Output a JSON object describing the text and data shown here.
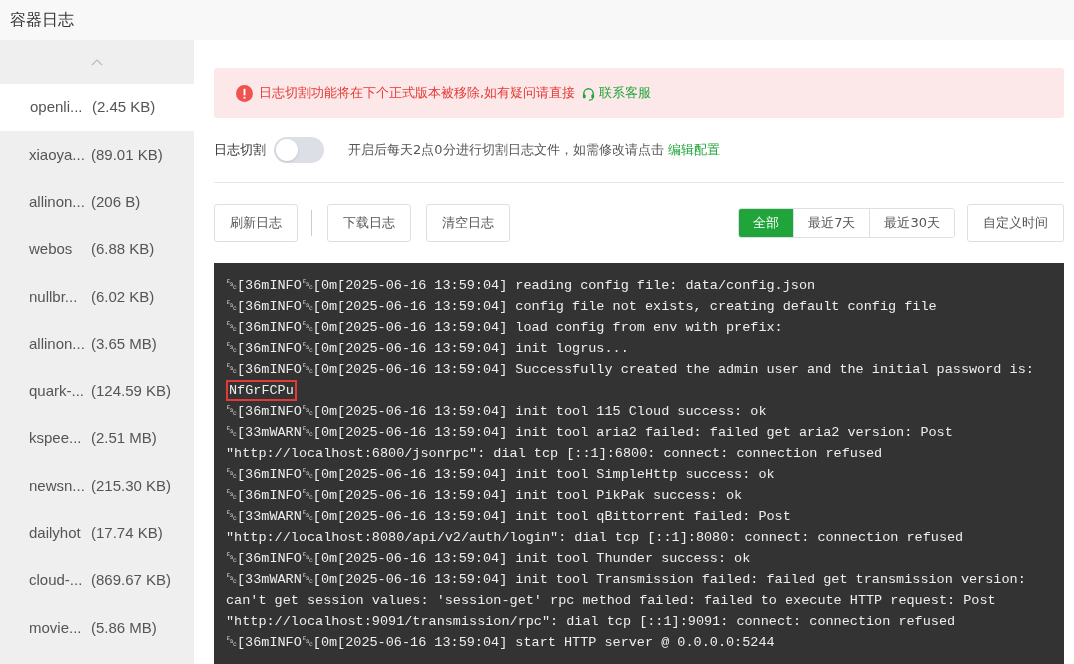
{
  "header": {
    "title": "容器日志"
  },
  "sidebar": {
    "items": [
      {
        "name": "openli...",
        "size": "(2.45 KB)",
        "selected": true
      },
      {
        "name": "xiaoya...",
        "size": "(89.01 KB)",
        "selected": false
      },
      {
        "name": "allinon...",
        "size": "(206 B)",
        "selected": false
      },
      {
        "name": "webos",
        "size": "(6.88 KB)",
        "selected": false
      },
      {
        "name": "nullbr...",
        "size": "(6.02 KB)",
        "selected": false
      },
      {
        "name": "allinon...",
        "size": "(3.65 MB)",
        "selected": false
      },
      {
        "name": "quark-...",
        "size": "(124.59 KB)",
        "selected": false
      },
      {
        "name": "kspee...",
        "size": "(2.51 MB)",
        "selected": false
      },
      {
        "name": "newsn...",
        "size": "(215.30 KB)",
        "selected": false
      },
      {
        "name": "dailyhot",
        "size": "(17.74 KB)",
        "selected": false
      },
      {
        "name": "cloud-...",
        "size": "(869.67 KB)",
        "selected": false
      },
      {
        "name": "movie...",
        "size": "(5.86 MB)",
        "selected": false
      }
    ]
  },
  "alert": {
    "message": "日志切割功能将在下个正式版本被移除,如有疑问请直接",
    "link": "联系客服"
  },
  "rotation": {
    "label": "日志切割",
    "on": false,
    "description": "开启后每天2点0分进行切割日志文件，如需修改请点击",
    "link": "编辑配置"
  },
  "actions": [
    "刷新日志",
    "下载日志",
    "清空日志"
  ],
  "filters": [
    {
      "label": "全部",
      "selected": true
    },
    {
      "label": "最近7天",
      "selected": false
    },
    {
      "label": "最近30天",
      "selected": false
    }
  ],
  "custom_time": "自定义时间",
  "log": [
    {
      "text": "␛[36mINFO␛[0m[2025-06-16 13:59:04] reading config file: data/config.json"
    },
    {
      "text": "␛[36mINFO␛[0m[2025-06-16 13:59:04] config file not exists, creating default config file"
    },
    {
      "text": "␛[36mINFO␛[0m[2025-06-16 13:59:04] load config from env with prefix:"
    },
    {
      "text": "␛[36mINFO␛[0m[2025-06-16 13:59:04] init logrus..."
    },
    {
      "text": "␛[36mINFO␛[0m[2025-06-16 13:59:04] Successfully created the admin user and the initial password is:",
      "highlight": "NfGrFCPu"
    },
    {
      "text": "␛[36mINFO␛[0m[2025-06-16 13:59:04] init tool 115 Cloud success: ok"
    },
    {
      "text": "␛[33mWARN␛[0m[2025-06-16 13:59:04] init tool aria2 failed: failed get aria2 version: Post \"http://localhost:6800/jsonrpc\": dial tcp [::1]:6800: connect: connection refused"
    },
    {
      "text": "␛[36mINFO␛[0m[2025-06-16 13:59:04] init tool SimpleHttp success: ok"
    },
    {
      "text": "␛[36mINFO␛[0m[2025-06-16 13:59:04] init tool PikPak success: ok"
    },
    {
      "text": "␛[33mWARN␛[0m[2025-06-16 13:59:04] init tool qBittorrent failed: Post \"http://localhost:8080/api/v2/auth/login\": dial tcp [::1]:8080: connect: connection refused"
    },
    {
      "text": "␛[36mINFO␛[0m[2025-06-16 13:59:04] init tool Thunder success: ok"
    },
    {
      "text": "␛[33mWARN␛[0m[2025-06-16 13:59:04] init tool Transmission failed: failed get transmission version: can't get session values: 'session-get' rpc method failed: failed to execute HTTP request: Post \"http://localhost:9091/transmission/rpc\": dial tcp [::1]:9091: connect: connection refused"
    },
    {
      "text": "␛[36mINFO␛[0m[2025-06-16 13:59:04] start HTTP server @ 0.0.0.0:5244"
    }
  ]
}
